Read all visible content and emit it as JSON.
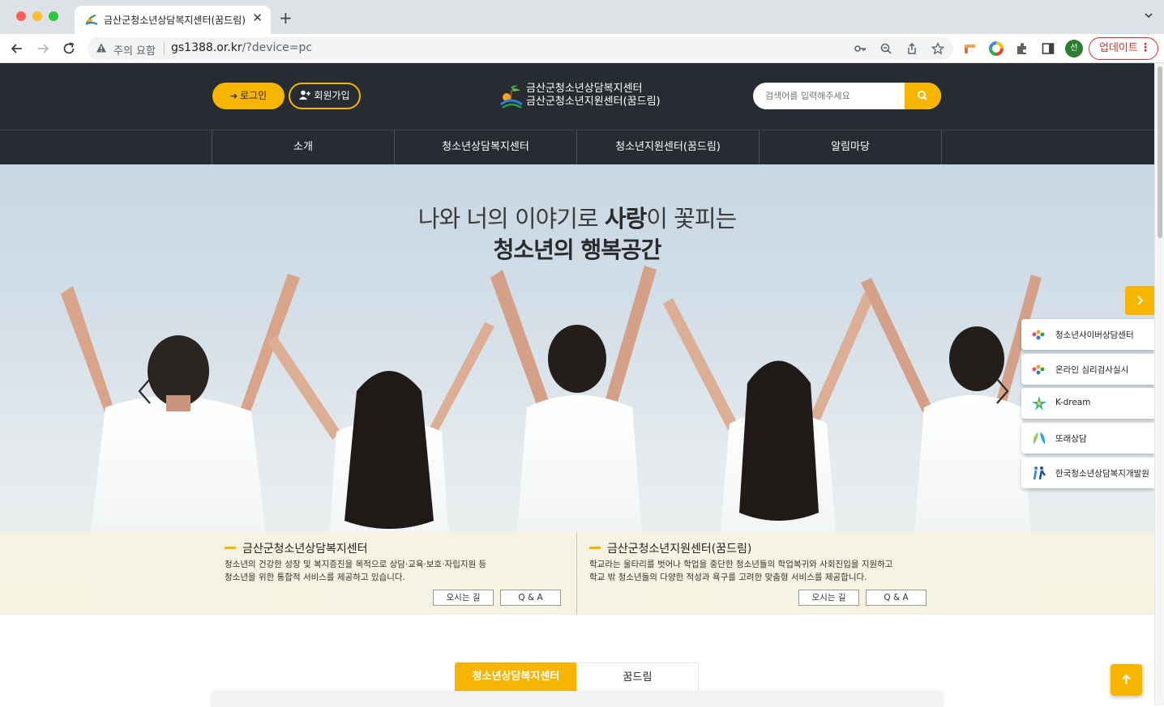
{
  "browser": {
    "tab_title": "금산군청소년상담복지센터(꿈드림)",
    "new_tab_glyph": "+",
    "close_glyph": "✕",
    "security_warning": "주의 요함",
    "url_host": "gs1388.or.kr",
    "url_path": "/?device=pc",
    "profile_initial": "선",
    "update_label": "업데이트",
    "menu_glyph": "⋮"
  },
  "header": {
    "login_label": "로그인",
    "join_label": "회원가입",
    "logo_line1": "금산군청소년상담복지센터",
    "logo_line2": "금산군청소년지원센터(꿈드림)",
    "search_placeholder": "검색어를 입력해주세요"
  },
  "gnb": {
    "items": [
      {
        "label": "소개"
      },
      {
        "label": "청소년상담복지센터"
      },
      {
        "label": "청소년지원센터(꿈드림)"
      },
      {
        "label": "알림마당"
      }
    ]
  },
  "hero": {
    "line1_pre": "나와 너의 이야기로 ",
    "line1_bold": "사랑",
    "line1_post": "이 꽃피는",
    "line2": "청소년의 행복공간"
  },
  "info": [
    {
      "title": "금산군청소년상담복지센터",
      "desc_line1": "청소년의 건강한 성장 및 복지증진을 목적으로 상담·교육·보호·자립지원 등",
      "desc_line2": "청소년을 위한 통합적 서비스를 제공하고 있습니다.",
      "btn_directions": "오시는 길",
      "btn_qa": "Q & A"
    },
    {
      "title": "금산군청소년지원센터(꿈드림)",
      "desc_line1": "학교라는 울타리를 벗어나 학업을 중단한 청소년들의 학업복귀와 사회진입을 지원하고",
      "desc_line2": "학교 밖 청소년들의 다양한 적성과 욕구를 고려한 맞춤형 서비스를 제공합니다.",
      "btn_directions": "오시는 길",
      "btn_qa": "Q & A"
    }
  ],
  "quick_menu": {
    "items": [
      {
        "label": "청소년사이버상담센터",
        "icon": "cyber-counsel-icon"
      },
      {
        "label": "온라인 심리검사실시",
        "icon": "online-test-icon"
      },
      {
        "label": "K-dream",
        "icon": "k-dream-icon"
      },
      {
        "label": "또래상담",
        "icon": "peer-counsel-icon"
      },
      {
        "label": "한국청소년상담복지개발원",
        "icon": "kyci-icon"
      }
    ]
  },
  "tabs": {
    "active_label": "청소년상담복지센터",
    "inactive_label": "꿈드림"
  },
  "colors": {
    "accent": "#f8b500",
    "header_bg": "#272c33"
  }
}
